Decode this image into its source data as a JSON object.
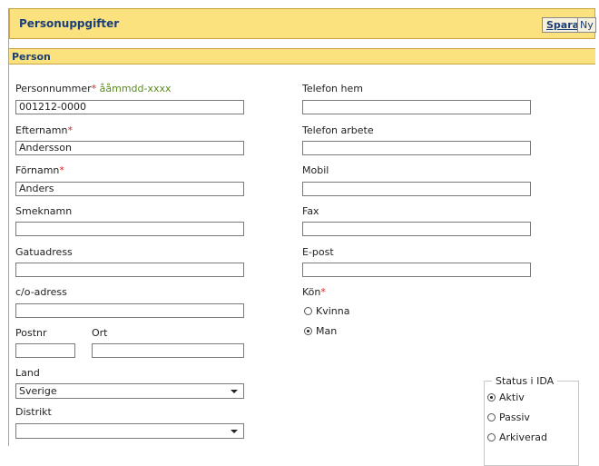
{
  "header": {
    "title": "Personuppgifter",
    "save_label": "Spara",
    "new_label": "Ny"
  },
  "section": {
    "title": "Person"
  },
  "left": {
    "personnummer": {
      "label": "Personnummer",
      "required": "*",
      "hint": " ååmmdd-xxxx",
      "value": "001212-0000"
    },
    "efternamn": {
      "label": "Efternamn",
      "required": "*",
      "value": "Andersson"
    },
    "fornamn": {
      "label": "Förnamn",
      "required": "*",
      "value": "Anders"
    },
    "smeknamn": {
      "label": "Smeknamn",
      "value": ""
    },
    "gatuadress": {
      "label": "Gatuadress",
      "value": ""
    },
    "co_adress": {
      "label": "c/o-adress",
      "value": ""
    },
    "postnr": {
      "label": "Postnr",
      "value": ""
    },
    "ort": {
      "label": "Ort",
      "value": ""
    },
    "land": {
      "label": "Land",
      "selected": "Sverige"
    },
    "distrikt": {
      "label": "Distrikt",
      "selected": ""
    }
  },
  "right": {
    "telefon_hem": {
      "label": "Telefon hem",
      "value": ""
    },
    "telefon_arbete": {
      "label": "Telefon arbete",
      "value": ""
    },
    "mobil": {
      "label": "Mobil",
      "value": ""
    },
    "fax": {
      "label": "Fax",
      "value": ""
    },
    "epost": {
      "label": "E-post",
      "value": ""
    },
    "kon": {
      "label": "Kön",
      "required": "*",
      "options": [
        "Kvinna",
        "Man"
      ],
      "selected": "Man"
    }
  },
  "status": {
    "legend": "Status i IDA",
    "options": [
      "Aktiv",
      "Passiv",
      "Arkiverad"
    ],
    "selected": "Aktiv"
  },
  "colors": {
    "header_bg": "#fce27f",
    "title_color": "#1a3e78",
    "border": "#c9a642",
    "required": "#d22",
    "hint": "#5a8a1e"
  }
}
